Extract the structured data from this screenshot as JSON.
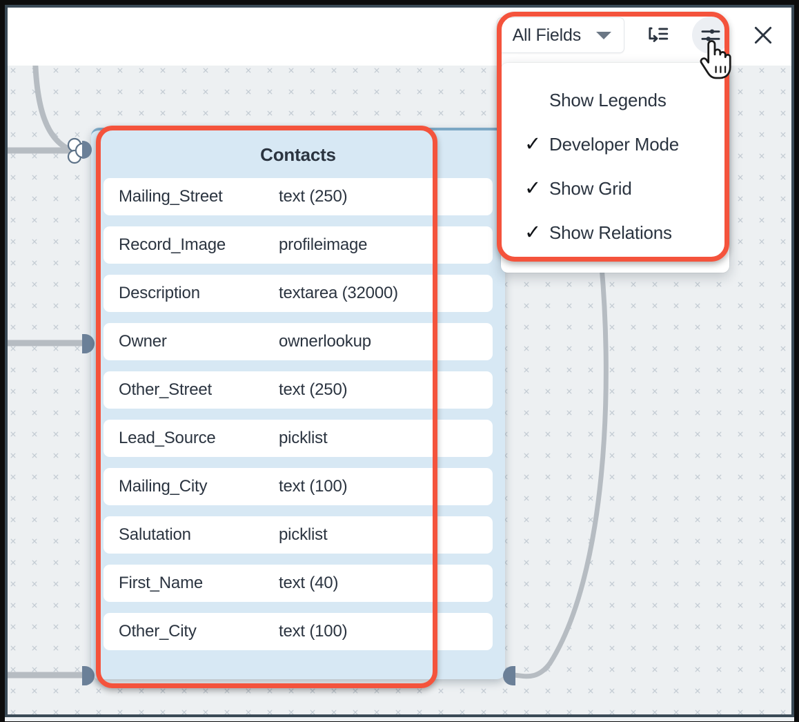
{
  "toolbar": {
    "fields_filter": {
      "label": "All Fields",
      "icon": "chevron-down-icon"
    },
    "buttons": [
      {
        "name": "auto-layout-button",
        "icon": "indent-arrow-icon",
        "active": false
      },
      {
        "name": "view-settings-button",
        "icon": "sliders-icon",
        "active": true
      },
      {
        "name": "close-button",
        "icon": "close-icon",
        "active": false
      }
    ]
  },
  "settings_menu": {
    "items": [
      {
        "label": "Show Legends",
        "checked": false
      },
      {
        "label": "Developer Mode",
        "checked": true
      },
      {
        "label": "Show Grid",
        "checked": true
      },
      {
        "label": "Show Relations",
        "checked": true
      }
    ],
    "check_glyph": "✓"
  },
  "entity": {
    "title": "Contacts",
    "fields": [
      {
        "name": "Mailing_Street",
        "type": "text (250)"
      },
      {
        "name": "Record_Image",
        "type": "profileimage"
      },
      {
        "name": "Description",
        "type": "textarea (32000)"
      },
      {
        "name": "Owner",
        "type": "ownerlookup"
      },
      {
        "name": "Other_Street",
        "type": "text (250)"
      },
      {
        "name": "Lead_Source",
        "type": "picklist"
      },
      {
        "name": "Mailing_City",
        "type": "text (100)"
      },
      {
        "name": "Salutation",
        "type": "picklist"
      },
      {
        "name": "First_Name",
        "type": "text (40)"
      },
      {
        "name": "Other_City",
        "type": "text (100)"
      }
    ]
  },
  "colors": {
    "highlight": "#f4533c",
    "card_bg": "#d7e8f4",
    "canvas_bg": "#edf0f2",
    "text": "#2b3440",
    "port": "#6b8098",
    "edge": "#b6bcc2",
    "frame": "#3a4a56"
  },
  "canvas": {
    "grid_marker": "x",
    "grid_spacing": 31
  }
}
